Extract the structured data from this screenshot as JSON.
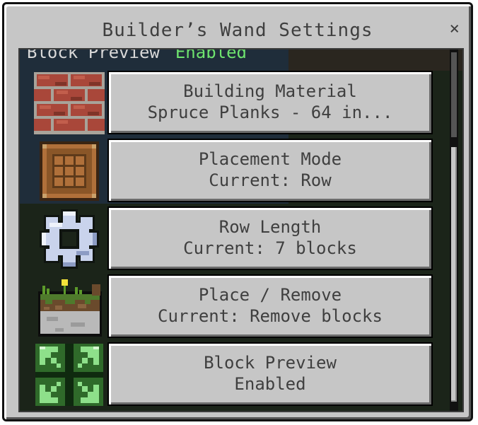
{
  "dialog": {
    "title": "Builder’s Wand Settings",
    "close_glyph": "×"
  },
  "preview_peek": {
    "label": "Block Preview",
    "status": "Enabled"
  },
  "settings": [
    {
      "icon": "brick-block-icon",
      "title": "Building Material",
      "value": "Spruce Planks  - 64 in..."
    },
    {
      "icon": "crafting-table-icon",
      "title": "Placement Mode",
      "value": "Current: Row"
    },
    {
      "icon": "gear-icon",
      "title": "Row Length",
      "value": "Current: 7 blocks"
    },
    {
      "icon": "grass-block-icon",
      "title": "Place / Remove",
      "value": "Current: Remove blocks"
    },
    {
      "icon": "expand-arrows-icon",
      "title": "Block Preview",
      "value": "Enabled"
    }
  ],
  "colors": {
    "panel_bg": "#c6c6c6",
    "button_text": "#3f3f3f",
    "enabled_green": "#6ee36e"
  }
}
